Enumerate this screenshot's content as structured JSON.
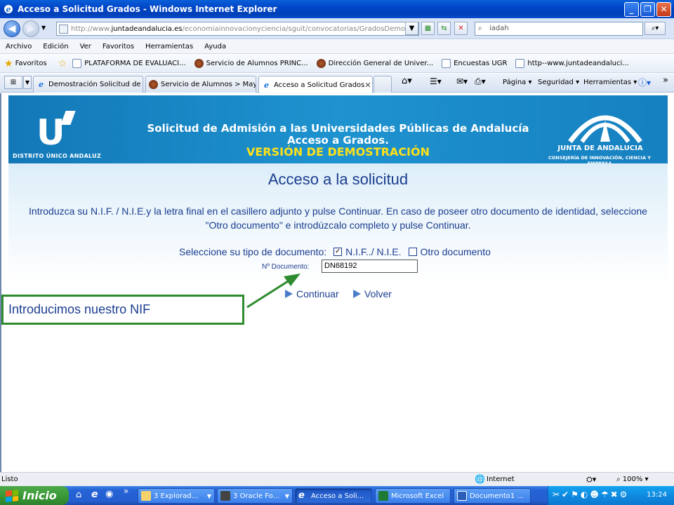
{
  "window": {
    "title": "Acceso a Solicitud Grados - Windows Internet Explorer"
  },
  "address": {
    "url_prefix": "http://www.",
    "url_domain": "juntadeandalucia.es",
    "url_path": "/economiainnovacionyciencia/sguit/convocatorias/GradosDemo/acceso.p",
    "search_value": "iadah"
  },
  "menu": [
    "Archivo",
    "Edición",
    "Ver",
    "Favoritos",
    "Herramientas",
    "Ayuda"
  ],
  "favorites": {
    "label": "Favoritos",
    "items": [
      "PLATAFORMA DE EVALUACI...",
      "Servicio de Alumnos PRINC...",
      "Dirección General de Univer...",
      "Encuestas UGR",
      "http--www.juntadeandaluci..."
    ]
  },
  "tabs": [
    "Demostración Solicitud de A...",
    "Servicio de Alumnos > May...",
    "Acceso a Solicitud Grados"
  ],
  "commands": {
    "page": "Página",
    "security": "Seguridad",
    "tools": "Herramientas"
  },
  "banner": {
    "logo_text": "DISTRITO ÚNICO ANDALUZ",
    "title_line1": "Solicitud de Admisión a las Universidades Públicas de Andalucía",
    "title_line2": "Acceso a Grados.",
    "title_line3": "VERSIÓN DE DEMOSTRACIÓN",
    "junta": "JUNTA DE ANDALUCIA",
    "junta_sub": "CONSEJERÍA DE INNOVACIÓN, CIENCIA Y EMPRESA"
  },
  "form": {
    "heading": "Acceso a la solicitud",
    "intro_line1": "Introduzca su N.I.F. / N.I.E.y la letra final en el casillero adjunto y pulse Continuar. En caso de poseer otro documento de identidad, seleccione",
    "intro_line2": "\"Otro documento\" e introdúzcalo completo y pulse Continuar.",
    "doc_type_label": "Seleccione su tipo de documento:",
    "option_nif": "N.I.F../ N.I.E.",
    "option_other": "Otro documento",
    "doc_number_label": "Nº Documento:",
    "doc_number_value": "DN68192",
    "continue": "Continuar",
    "back": "Volver"
  },
  "callout": {
    "text": "Introducimos nuestro NIF"
  },
  "status": {
    "left": "Listo",
    "zone": "Internet",
    "zoom": "100%"
  },
  "taskbar": {
    "start": "Inicio",
    "items": [
      "3 Explorad...",
      "3 Oracle Fo...",
      "Acceso a Soli...",
      "Microsoft Excel",
      "Documento1 ..."
    ],
    "clock": "13:24"
  }
}
